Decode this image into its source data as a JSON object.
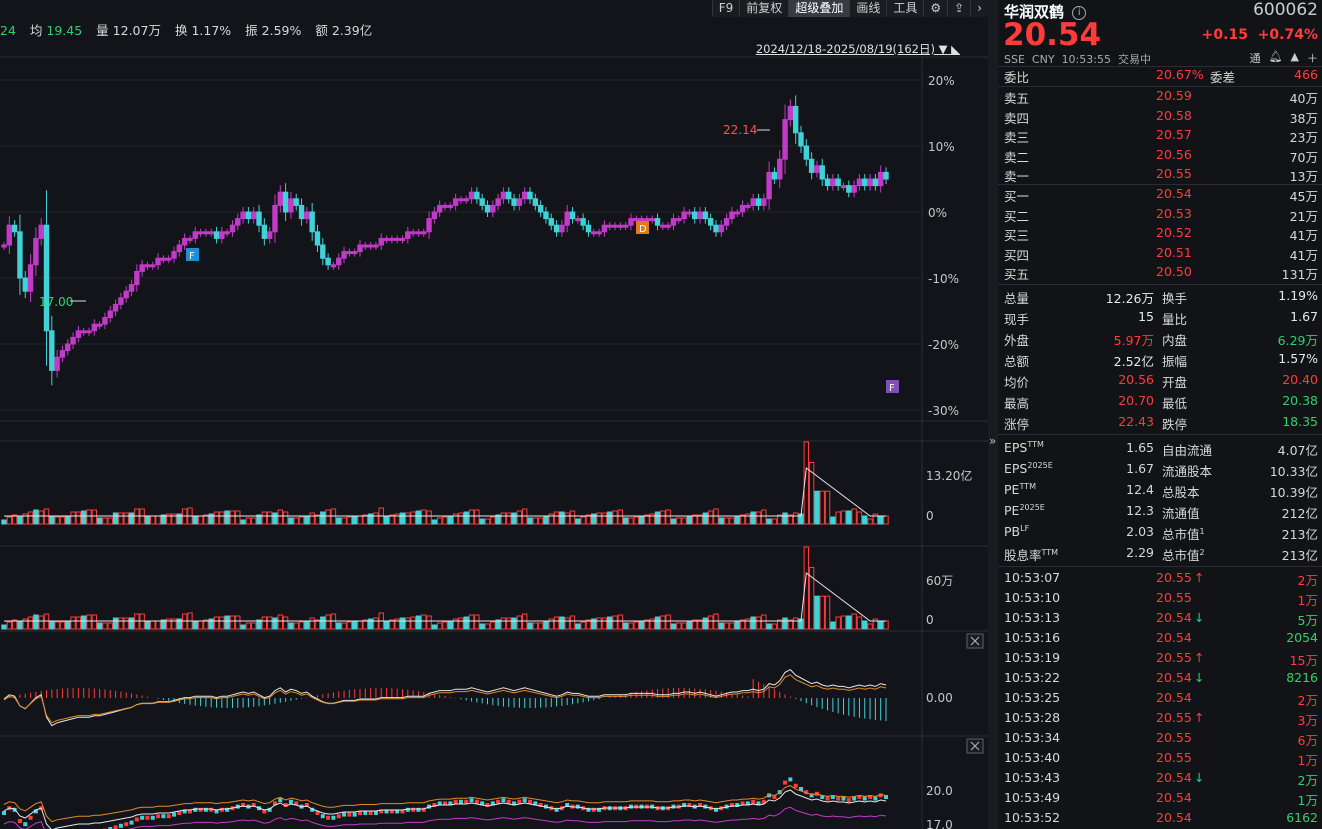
{
  "stats": {
    "prev_fragment": "24",
    "avg_label": "均",
    "avg_value": "19.45",
    "vol_label": "量",
    "vol_value": "12.07万",
    "turn_label": "换",
    "turn_value": "1.17%",
    "amp_label": "振",
    "amp_value": "2.59%",
    "amt_label": "额",
    "amt_value": "2.39亿"
  },
  "toolbar": [
    "F9",
    "前复权",
    "超级叠加",
    "画线",
    "工具"
  ],
  "toolbar_icons": [
    "gear-icon",
    "upload-icon",
    "chevron-right-icon"
  ],
  "date_range": "2024/12/18-2025/08/19(162日)",
  "main_axis": [
    "20%",
    "10%",
    "0%",
    "-10%",
    "-20%",
    "-30%"
  ],
  "annotations": {
    "high_label": "22.14",
    "low_label": "17.00",
    "marker_f1": "F",
    "marker_d": "D",
    "marker_f2": "F"
  },
  "vol_axis": [
    "13.20亿",
    "0"
  ],
  "vol2_axis": [
    "60万",
    "0"
  ],
  "macd_axis": [
    "0.00"
  ],
  "ma_axis": [
    "20.0",
    "17.0"
  ],
  "stock": {
    "name": "华润双鹤",
    "code": "600062",
    "price": "20.54",
    "change": "+0.15",
    "change_pct": "+0.74%",
    "exchange": "SSE",
    "currency": "CNY",
    "time": "10:53:55",
    "status": "交易中",
    "tag": "通"
  },
  "weibi": {
    "label": "委比",
    "value": "20.67%",
    "diff_label": "委差",
    "diff_value": "466"
  },
  "asks": [
    {
      "label": "卖五",
      "price": "20.59",
      "vol": "40万"
    },
    {
      "label": "卖四",
      "price": "20.58",
      "vol": "38万"
    },
    {
      "label": "卖三",
      "price": "20.57",
      "vol": "23万"
    },
    {
      "label": "卖二",
      "price": "20.56",
      "vol": "70万"
    },
    {
      "label": "卖一",
      "price": "20.55",
      "vol": "13万"
    }
  ],
  "bids": [
    {
      "label": "买一",
      "price": "20.54",
      "vol": "45万"
    },
    {
      "label": "买二",
      "price": "20.53",
      "vol": "21万"
    },
    {
      "label": "买三",
      "price": "20.52",
      "vol": "41万"
    },
    {
      "label": "买四",
      "price": "20.51",
      "vol": "41万"
    },
    {
      "label": "买五",
      "price": "20.50",
      "vol": "131万"
    }
  ],
  "quote": [
    {
      "l1": "总量",
      "v1": "12.26万",
      "c1": "white",
      "l2": "换手",
      "v2": "1.19%",
      "c2": "white"
    },
    {
      "l1": "现手",
      "v1": "15",
      "c1": "white",
      "l2": "量比",
      "v2": "1.67",
      "c2": "white"
    },
    {
      "l1": "外盘",
      "v1": "5.97万",
      "c1": "red",
      "l2": "内盘",
      "v2": "6.29万",
      "c2": "green"
    },
    {
      "l1": "总额",
      "v1": "2.52亿",
      "c1": "white",
      "l2": "振幅",
      "v2": "1.57%",
      "c2": "white"
    },
    {
      "l1": "均价",
      "v1": "20.56",
      "c1": "red",
      "l2": "开盘",
      "v2": "20.40",
      "c2": "red"
    },
    {
      "l1": "最高",
      "v1": "20.70",
      "c1": "red",
      "l2": "最低",
      "v2": "20.38",
      "c2": "green"
    },
    {
      "l1": "涨停",
      "v1": "22.43",
      "c1": "red",
      "l2": "跌停",
      "v2": "18.35",
      "c2": "green"
    }
  ],
  "fund": [
    {
      "l1": "EPS",
      "s1": "TTM",
      "v1": "1.65",
      "l2": "自由流通",
      "s2": "",
      "v2": "4.07亿"
    },
    {
      "l1": "EPS",
      "s1": "2025E",
      "v1": "1.67",
      "l2": "流通股本",
      "s2": "",
      "v2": "10.33亿"
    },
    {
      "l1": "PE",
      "s1": "TTM",
      "v1": "12.4",
      "l2": "总股本",
      "s2": "",
      "v2": "10.39亿"
    },
    {
      "l1": "PE",
      "s1": "2025E",
      "v1": "12.3",
      "l2": "流通值",
      "s2": "",
      "v2": "212亿"
    },
    {
      "l1": "PB",
      "s1": "LF",
      "v1": "2.03",
      "l2": "总市值",
      "s2": "1",
      "v2": "213亿"
    },
    {
      "l1": "股息率",
      "s1": "TTM",
      "v1": "2.29",
      "l2": "总市值",
      "s2": "2",
      "v2": "213亿"
    }
  ],
  "ticks": [
    {
      "time": "10:53:07",
      "price": "20.55",
      "dir": "up",
      "vol": "2万",
      "vc": "red"
    },
    {
      "time": "10:53:10",
      "price": "20.55",
      "dir": "",
      "vol": "1万",
      "vc": "red"
    },
    {
      "time": "10:53:13",
      "price": "20.54",
      "dir": "down",
      "vol": "5万",
      "vc": "green"
    },
    {
      "time": "10:53:16",
      "price": "20.54",
      "dir": "",
      "vol": "2054",
      "vc": "green"
    },
    {
      "time": "10:53:19",
      "price": "20.55",
      "dir": "up",
      "vol": "15万",
      "vc": "red"
    },
    {
      "time": "10:53:22",
      "price": "20.54",
      "dir": "down",
      "vol": "8216",
      "vc": "green"
    },
    {
      "time": "10:53:25",
      "price": "20.54",
      "dir": "",
      "vol": "2万",
      "vc": "red"
    },
    {
      "time": "10:53:28",
      "price": "20.55",
      "dir": "up",
      "vol": "3万",
      "vc": "red"
    },
    {
      "time": "10:53:34",
      "price": "20.55",
      "dir": "",
      "vol": "6万",
      "vc": "red"
    },
    {
      "time": "10:53:40",
      "price": "20.55",
      "dir": "",
      "vol": "1万",
      "vc": "red"
    },
    {
      "time": "10:53:43",
      "price": "20.54",
      "dir": "down",
      "vol": "2万",
      "vc": "green"
    },
    {
      "time": "10:53:49",
      "price": "20.54",
      "dir": "",
      "vol": "1万",
      "vc": "green"
    },
    {
      "time": "10:53:52",
      "price": "20.54",
      "dir": "",
      "vol": "6162",
      "vc": "green"
    }
  ],
  "colors": {
    "up": "#ff3b3b",
    "down": "#3ad3d6",
    "magenta": "#c23ac8",
    "cyan": "#3fd2d6",
    "bg": "#131419"
  }
}
